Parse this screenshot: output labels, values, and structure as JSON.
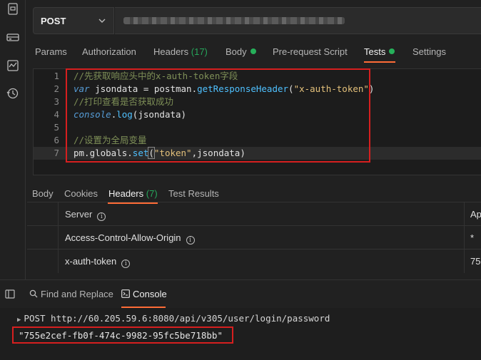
{
  "sidebar": {
    "icons": [
      "import-icon",
      "environment-icon",
      "monitor-icon",
      "history-icon"
    ]
  },
  "request": {
    "method": "POST"
  },
  "tabs": {
    "params": "Params",
    "authorization": "Authorization",
    "headers": "Headers",
    "headers_count": "(17)",
    "body": "Body",
    "prerequest": "Pre-request Script",
    "tests": "Tests",
    "settings": "Settings"
  },
  "editor": {
    "line_numbers": [
      "1",
      "2",
      "3",
      "4",
      "5",
      "6",
      "7"
    ],
    "line1": "//先获取响应头中的x-auth-token字段",
    "line2_kw": "var",
    "line2_a": " jsondata = postman.",
    "line2_fn": "getResponseHeader",
    "line2_b": "(",
    "line2_str": "\"x-auth-token\"",
    "line2_c": ")",
    "line3": "//打印查看是否获取成功",
    "line4_kw": "console",
    "line4_a": ".",
    "line4_fn": "log",
    "line4_b": "(jsondata)",
    "line6": "//设置为全局变量",
    "line7_a": "pm.globals.",
    "line7_fn": "set",
    "line7_b": "(",
    "line7_str": "\"token\"",
    "line7_c": ",jsondata)"
  },
  "response": {
    "tabs": {
      "body": "Body",
      "cookies": "Cookies",
      "headers": "Headers",
      "headers_count": "(7)",
      "test_results": "Test Results"
    },
    "rows": [
      {
        "key": "Server",
        "value": "Ap"
      },
      {
        "key": "Access-Control-Allow-Origin",
        "value": "*"
      },
      {
        "key": "x-auth-token",
        "value": "75"
      }
    ]
  },
  "console_bar": {
    "find_replace": "Find and Replace",
    "console": "Console"
  },
  "console": {
    "request_line": "POST http://60.205.59.6:8080/api/v305/user/login/password",
    "output": "\"755e2cef-fb0f-474c-9982-95fc5be718bb\""
  },
  "colors": {
    "accent": "#ff6c37",
    "status_green": "#26b05a",
    "highlight_red": "#d61f1f"
  }
}
